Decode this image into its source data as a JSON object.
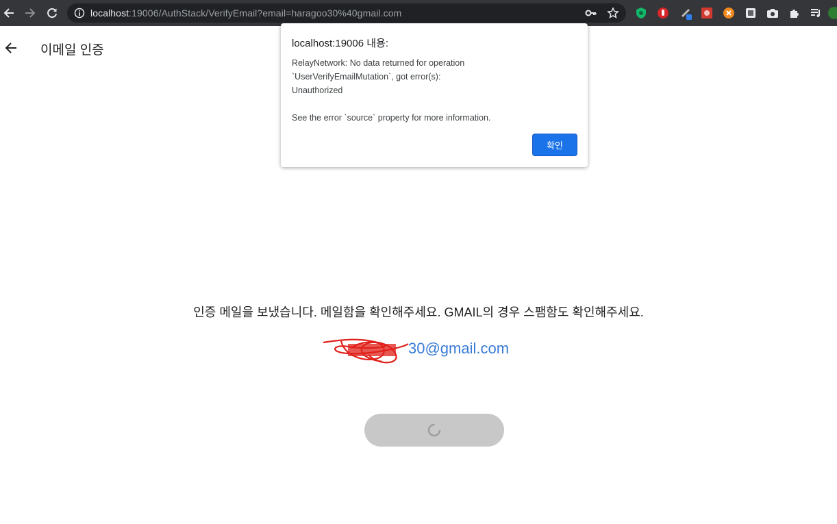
{
  "browser": {
    "url_host": "localhost",
    "url_rest": ":19006/AuthStack/VerifyEmail?email=haragoo30%40gmail.com",
    "profile_initial": "",
    "colors": {
      "toolbar": "#35363a",
      "omnibox": "#202124"
    }
  },
  "page": {
    "header_title": "이메일 인증",
    "message": "인증 메일을 보냈습니다. 메일함을 확인해주세요. GMAIL의 경우 스팸함도 확인해주세요.",
    "email_visible": "30@gmail.com",
    "email_color": "#3a7bd5",
    "submit_button": {
      "state": "loading",
      "icon": "spinner-icon"
    }
  },
  "dialog": {
    "title": "localhost:19006 내용:",
    "body": "RelayNetwork: No data returned for operation\n`UserVerifyEmailMutation`, got error(s):\nUnauthorized\n\nSee the error `source` property for more information.",
    "ok_label": "확인",
    "ok_color": "#1a73e8"
  }
}
